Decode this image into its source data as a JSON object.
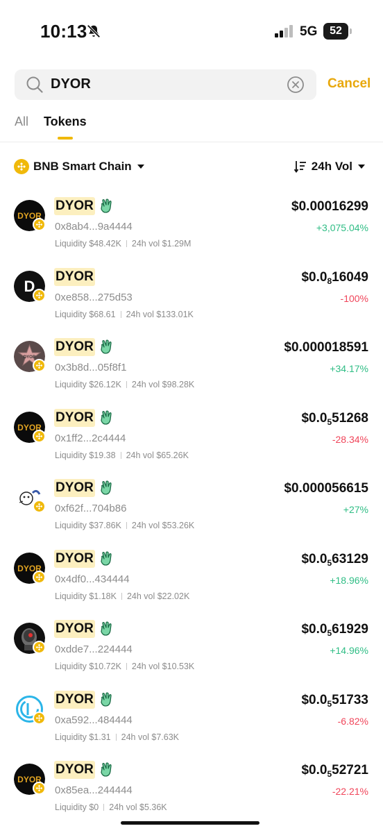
{
  "status_bar": {
    "time": "10:13",
    "network": "5G",
    "battery": "52"
  },
  "search": {
    "query": "DYOR",
    "cancel_label": "Cancel"
  },
  "tabs": [
    {
      "label": "All"
    },
    {
      "label": "Tokens"
    }
  ],
  "filters": {
    "chain": "BNB Smart Chain",
    "sort": "24h Vol"
  },
  "colors": {
    "accent": "#f0b90b",
    "cancel": "#e8a80d",
    "positive": "#2fbd85",
    "negative": "#f0455a"
  },
  "tokens": [
    {
      "name": "DYOR",
      "address": "0x8ab4...9a4444",
      "liquidity": "Liquidity $48.42K",
      "vol": "24h vol $1.29M",
      "price_main": "$0.00016299",
      "price_sub": "",
      "price_tail": "",
      "change": "+3,075.04%",
      "trend": "up",
      "verified": true,
      "logo": "dyor-gold"
    },
    {
      "name": "DYOR",
      "address": "0xe858...275d53",
      "liquidity": "Liquidity $68.61",
      "vol": "24h vol $133.01K",
      "price_main": "$0.0",
      "price_sub": "8",
      "price_tail": "16049",
      "change": "-100%",
      "trend": "down",
      "verified": false,
      "logo": "letter-d"
    },
    {
      "name": "DYOR",
      "address": "0x3b8d...05f8f1",
      "liquidity": "Liquidity $26.12K",
      "vol": "24h vol $98.28K",
      "price_main": "$0.000018591",
      "price_sub": "",
      "price_tail": "",
      "change": "+34.17%",
      "trend": "up",
      "verified": true,
      "logo": "star"
    },
    {
      "name": "DYOR",
      "address": "0x1ff2...2c4444",
      "liquidity": "Liquidity $19.38",
      "vol": "24h vol $65.26K",
      "price_main": "$0.0",
      "price_sub": "5",
      "price_tail": "51268",
      "change": "-28.34%",
      "trend": "down",
      "verified": true,
      "logo": "dyor-gold"
    },
    {
      "name": "DYOR",
      "address": "0xf62f...704b86",
      "liquidity": "Liquidity $37.86K",
      "vol": "24h vol $53.26K",
      "price_main": "$0.000056615",
      "price_sub": "",
      "price_tail": "",
      "change": "+27%",
      "trend": "up",
      "verified": true,
      "logo": "cartoon"
    },
    {
      "name": "DYOR",
      "address": "0x4df0...434444",
      "liquidity": "Liquidity $1.18K",
      "vol": "24h vol $22.02K",
      "price_main": "$0.0",
      "price_sub": "5",
      "price_tail": "63129",
      "change": "+18.96%",
      "trend": "up",
      "verified": true,
      "logo": "dyor-gold"
    },
    {
      "name": "DYOR",
      "address": "0xdde7...224444",
      "liquidity": "Liquidity $10.72K",
      "vol": "24h vol $10.53K",
      "price_main": "$0.0",
      "price_sub": "5",
      "price_tail": "61929",
      "change": "+14.96%",
      "trend": "up",
      "verified": true,
      "logo": "robot"
    },
    {
      "name": "DYOR",
      "address": "0xa592...484444",
      "liquidity": "Liquidity $1.31",
      "vol": "24h vol $7.63K",
      "price_main": "$0.0",
      "price_sub": "5",
      "price_tail": "51733",
      "change": "-6.82%",
      "trend": "down",
      "verified": true,
      "logo": "blue-ring"
    },
    {
      "name": "DYOR",
      "address": "0x85ea...244444",
      "liquidity": "Liquidity $0",
      "vol": "24h vol $5.36K",
      "price_main": "$0.0",
      "price_sub": "5",
      "price_tail": "52721",
      "change": "-22.21%",
      "trend": "down",
      "verified": true,
      "logo": "dyor-gold"
    }
  ]
}
